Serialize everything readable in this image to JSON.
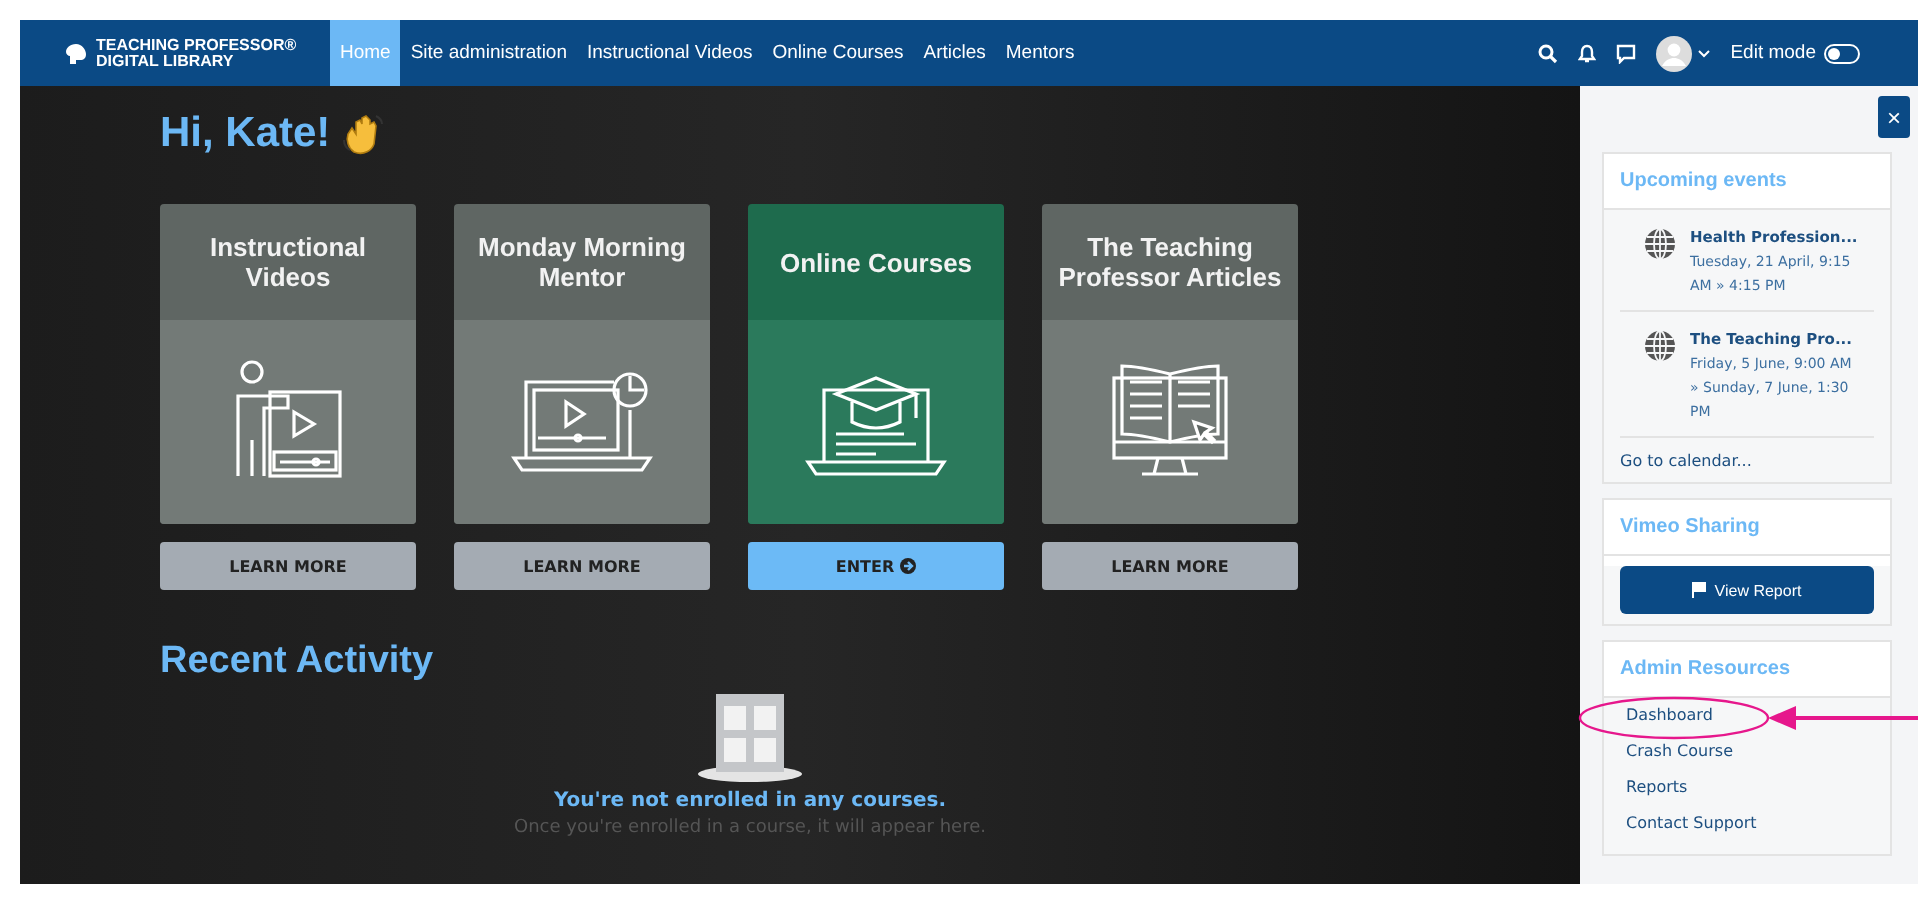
{
  "navbar": {
    "logo": [
      "TEACHING PROFESSOR®",
      "DIGITAL LIBRARY"
    ],
    "items": [
      {
        "label": "Home",
        "selected": true
      },
      {
        "label": "Site administration",
        "selected": false
      },
      {
        "label": "Instructional Videos",
        "selected": false
      },
      {
        "label": "Online Courses",
        "selected": false
      },
      {
        "label": "Articles",
        "selected": false
      },
      {
        "label": "Mentors",
        "selected": false
      }
    ],
    "edit_mode": {
      "label": "Edit mode",
      "on": false
    }
  },
  "greeting": "Hi, Kate!",
  "cards": [
    {
      "title": "Instructional Videos",
      "button": "LEARN MORE",
      "kind": "presenter",
      "highlighted": false
    },
    {
      "title": "Monday Morning Mentor",
      "button": "LEARN MORE",
      "kind": "laptop",
      "highlighted": false
    },
    {
      "title": "Online Courses",
      "button": "ENTER",
      "kind": "course",
      "highlighted": true
    },
    {
      "title": "The Teaching Professor Articles",
      "button": "LEARN MORE",
      "kind": "book",
      "highlighted": false
    }
  ],
  "recent_activity": {
    "heading": "Recent Activity",
    "message": "You're not enrolled in any courses.",
    "hint": "Once you're enrolled in a course, it will appear here."
  },
  "sidebar": {
    "close": "×",
    "upcoming_events": {
      "title": "Upcoming events",
      "events": [
        {
          "title": "Health Profession...",
          "date": "Tuesday, 21 April, 9:15 AM » 4:15 PM"
        },
        {
          "title": "The Teaching Pro...",
          "date": "Friday, 5 June, 9:00 AM » Sunday, 7 June, 1:30 PM"
        }
      ],
      "link": "Go to calendar..."
    },
    "vimeo": {
      "title": "Vimeo Sharing",
      "button": "View Report"
    },
    "admin": {
      "title": "Admin Resources",
      "links": [
        {
          "label": "Dashboard",
          "highlighted": true
        },
        {
          "label": "Crash Course",
          "highlighted": false
        },
        {
          "label": "Reports",
          "highlighted": false
        },
        {
          "label": "Contact Support",
          "highlighted": false
        }
      ]
    }
  }
}
